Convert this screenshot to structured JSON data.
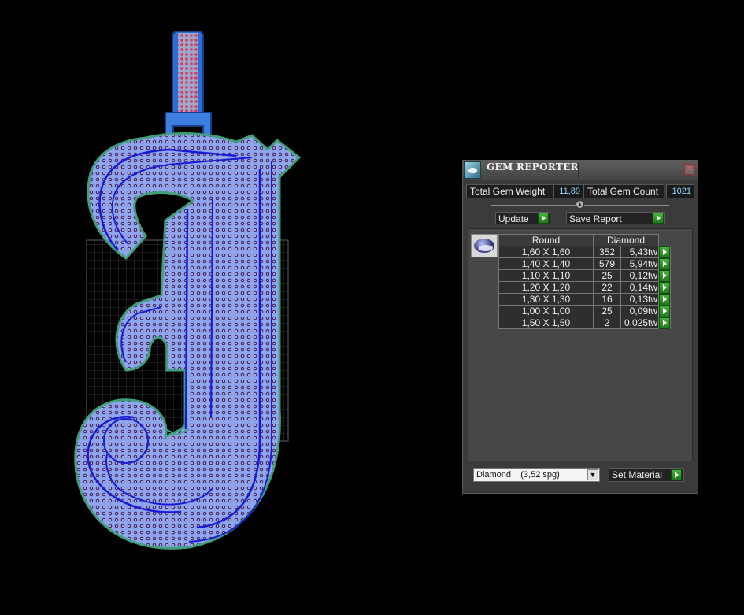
{
  "panel": {
    "title": "GEM REPORTER",
    "close_label": "✕",
    "total_weight_label": "Total Gem Weight",
    "total_weight_value": "11,89",
    "total_count_label": "Total Gem Count",
    "total_count_value": "1021",
    "update_label": "Update",
    "save_report_label": "Save Report",
    "table": {
      "shape_header": "Round",
      "material_header": "Diamond",
      "rows": [
        {
          "size": "1,60 X 1,60",
          "count": "352",
          "weight": "5,43tw"
        },
        {
          "size": "1,40 X 1,40",
          "count": "579",
          "weight": "5,94tw"
        },
        {
          "size": "1,10 X 1,10",
          "count": "25",
          "weight": "0,12tw"
        },
        {
          "size": "1,20 X 1,20",
          "count": "22",
          "weight": "0,14tw"
        },
        {
          "size": "1,30 X 1,30",
          "count": "16",
          "weight": "0,13tw"
        },
        {
          "size": "1,00 X 1,00",
          "count": "25",
          "weight": "0,09tw"
        },
        {
          "size": "1,50 X 1,50",
          "count": "2",
          "weight": "0,025tw"
        }
      ]
    },
    "material_select": "Diamond    (3,52 spg)",
    "set_material_label": "Set Material"
  },
  "colors": {
    "pendant_fill": "#8fa6ee",
    "pendant_outline": "#3fa07a",
    "gem_dots": "#4a2c66",
    "channel": "#1a1ad6",
    "bail": "#2b6fd6",
    "bail_stones": "#d23a6a",
    "panel_bg": "#3b3b3b",
    "value_text": "#8fd7ff",
    "accent_green": "#34a02c"
  }
}
